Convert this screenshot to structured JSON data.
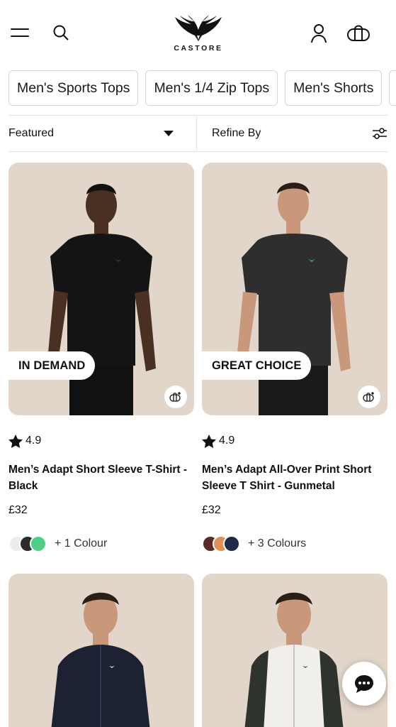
{
  "header": {
    "brand": "CASTORE",
    "icons": [
      "menu-icon",
      "search-icon",
      "account-icon",
      "bag-icon"
    ]
  },
  "categories": [
    "Men's Sports Tops",
    "Men's 1/4 Zip Tops",
    "Men's Shorts"
  ],
  "toolbar": {
    "sort_label": "Featured",
    "refine_label": "Refine By"
  },
  "products": [
    {
      "badge": "IN DEMAND",
      "rating": "4.9",
      "name": "Men’s Adapt Short Sleeve T-Shirt - Black",
      "price": "£32",
      "swatches": [
        "#ececec",
        "#2b2b2b",
        "#4fcf86"
      ],
      "colours": "+ 1 Colour",
      "shirt_color": "#141414",
      "logo_color": "#3a3a3a"
    },
    {
      "badge": "GREAT CHOICE",
      "rating": "4.9",
      "name": "Men’s Adapt All-Over Print Short Sleeve T Shirt - Gunmetal",
      "price": "£32",
      "swatches": [
        "#5a2a2a",
        "#e0915a",
        "#1f2a4a"
      ],
      "colours": "+ 3 Colours",
      "shirt_color": "#2e2e2e",
      "logo_color": "#3fbf5f"
    },
    {
      "jacket_color": "#1c2233"
    },
    {
      "jacket_color": "#f1efe9",
      "sleeve_color": "#2f332e"
    }
  ],
  "colors": {
    "card_bg": "#e2d5c9",
    "border": "#d6d6d6"
  }
}
